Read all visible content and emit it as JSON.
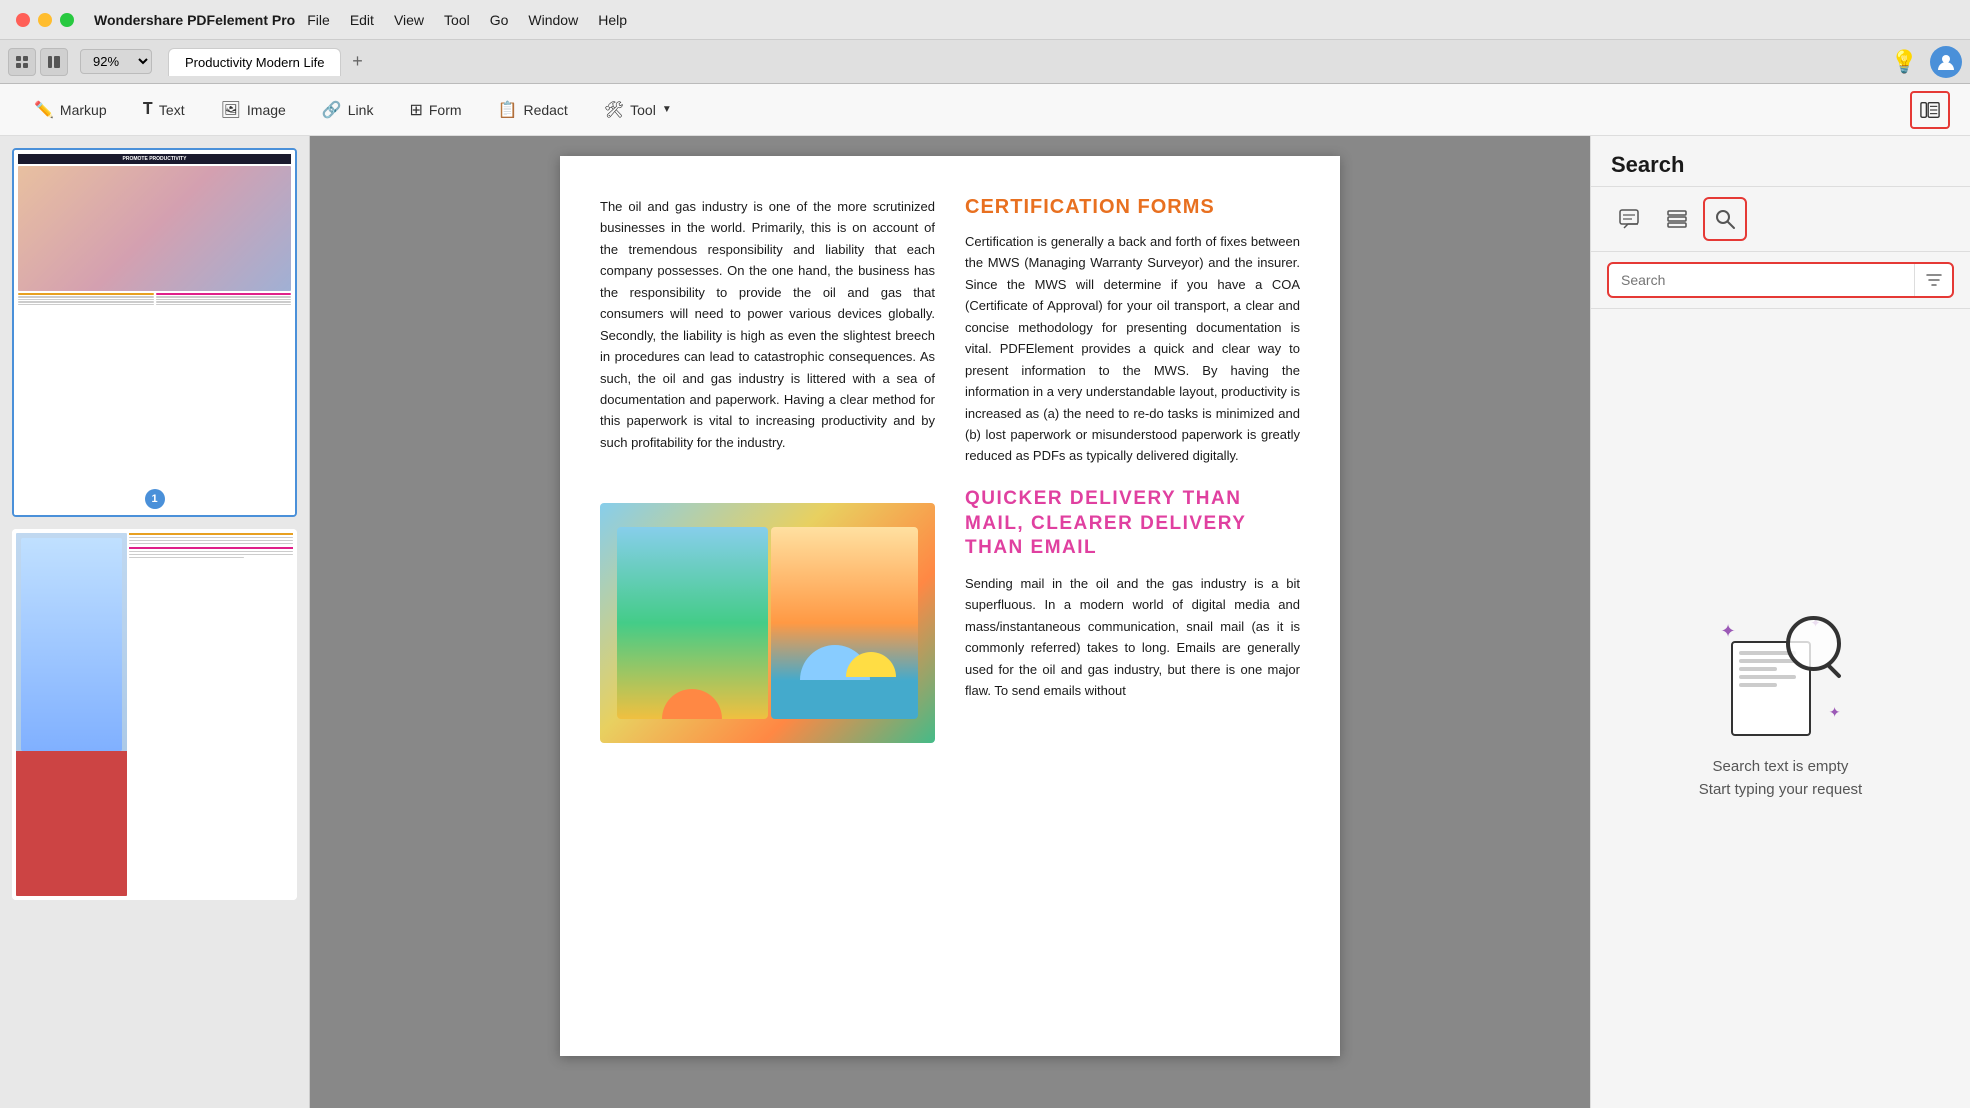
{
  "titlebar": {
    "app_name": "Wondershare PDFelement Pro",
    "menu_items": [
      "File",
      "Edit",
      "View",
      "Tool",
      "Go",
      "Window",
      "Help"
    ]
  },
  "tabbar": {
    "tab_title": "Productivity Modern Life",
    "zoom_level": "92%",
    "add_tab_label": "+"
  },
  "toolbar": {
    "markup_label": "Markup",
    "text_label": "Text",
    "image_label": "Image",
    "link_label": "Link",
    "form_label": "Form",
    "redact_label": "Redact",
    "tool_label": "Tool"
  },
  "pdf_content": {
    "body_text_left": "The oil and gas industry is one of the more scrutinized businesses in the world. Primarily, this is on account of the tremendous responsibility and liability that each company possesses. On the one hand, the business has the responsibility to provide the oil and gas that consumers will need to power various devices globally. Secondly, the liability is high as even the slightest breech in procedures can lead to catastrophic consequences. As such, the oil and gas industry is littered with a sea of documentation and paperwork. Having a clear method for this paperwork is vital to increasing productivity and by such profitability for the industry.",
    "cert_title": "CERTIFICATION FORMS",
    "cert_body": "Certification is generally a back and forth of fixes between the MWS (Managing Warranty Surveyor) and the insurer. Since the MWS will determine if you have a COA (Certificate of Approval) for your oil transport, a clear and concise methodology for presenting documentation is vital. PDFElement provides a quick and clear way to present information to the MWS. By having the information in a very understandable layout, productivity is increased as (a) the need to re-do tasks is minimized and (b) lost paperwork or misunderstood paperwork is greatly reduced as PDFs as typically delivered digitally.",
    "delivery_title": "QUICKER DELIVERY THAN MAIL, CLEARER DELIVERY THAN EMAIL",
    "delivery_body": "Sending mail in the oil and the gas industry is a bit superfluous. In a modern world of digital media and mass/instantaneous communication, snail mail (as it is commonly referred) takes to long. Emails are generally used for the oil and gas industry, but there is one major flaw. To send emails without"
  },
  "search_panel": {
    "title": "Search",
    "input_placeholder": "Search",
    "empty_title": "Search text is empty",
    "empty_subtitle": "Start typing your request"
  },
  "page_numbers": {
    "page1": "1"
  }
}
